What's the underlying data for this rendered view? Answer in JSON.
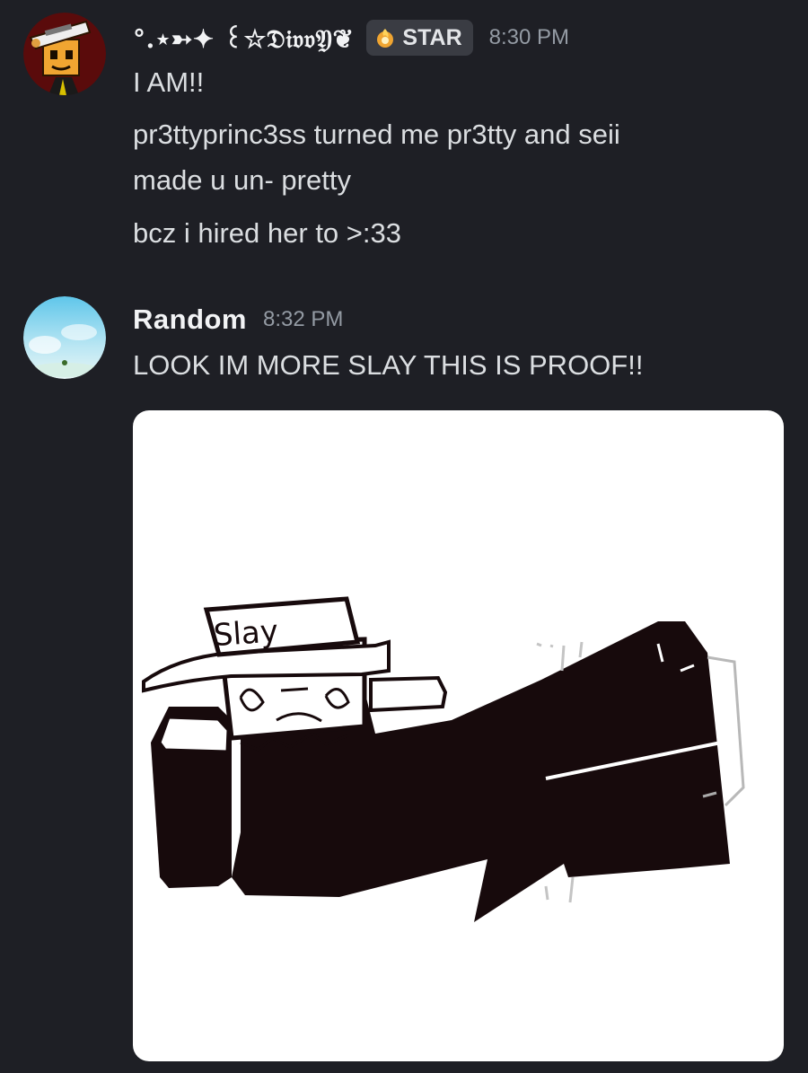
{
  "messages": [
    {
      "author": "°.⋆➳✦ ꒰☆𝔇𝔦𝔳𝔳𝔜❦",
      "clan_tag": "STAR",
      "timestamp": "8:30 PM",
      "lines": [
        "I AM!!",
        "pr3ttyprinc3ss turned me pr3tty and seii",
        "made u un- pretty",
        "bcz i hired her to >:33"
      ]
    },
    {
      "author": "Random",
      "timestamp": "8:32 PM",
      "lines": [
        "LOOK IM MORE SLAY THIS IS PROOF!!"
      ],
      "attachment": {
        "type": "drawing",
        "hat_text": "Slay"
      }
    }
  ],
  "colors": {
    "background": "#1e1f25",
    "username": "#f2f3f5",
    "message_text": "#dbdee1",
    "timestamp": "#949ba4",
    "clan_tag_bg": "#3a3c43"
  }
}
